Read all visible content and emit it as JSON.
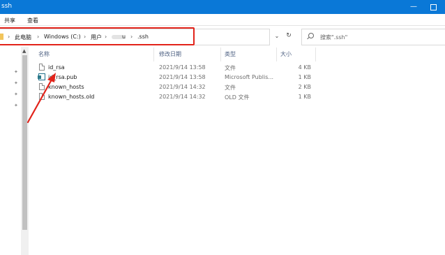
{
  "window": {
    "title": "ssh"
  },
  "ribbon": {
    "tabs": [
      "共享",
      "查看"
    ]
  },
  "address": {
    "crumbs": [
      "此电脑",
      "Windows (C:)",
      "用户",
      "u",
      ".ssh"
    ],
    "separator": "›"
  },
  "search": {
    "placeholder": "搜索\".ssh\""
  },
  "columns": {
    "name": "名称",
    "modified": "修改日期",
    "type": "类型",
    "size": "大小"
  },
  "files": [
    {
      "name": "id_rsa",
      "modified": "2021/9/14 13:58",
      "type": "文件",
      "size": "4 KB",
      "icon": "file-icon"
    },
    {
      "name": "id_rsa.pub",
      "modified": "2021/9/14 13:58",
      "type": "Microsoft Publis...",
      "size": "1 KB",
      "icon": "publisher-file-icon"
    },
    {
      "name": "known_hosts",
      "modified": "2021/9/14 14:32",
      "type": "文件",
      "size": "2 KB",
      "icon": "file-icon"
    },
    {
      "name": "known_hosts.old",
      "modified": "2021/9/14 14:32",
      "type": "OLD 文件",
      "size": "1 KB",
      "icon": "file-icon"
    }
  ],
  "colors": {
    "titlebar": "#0a78d7",
    "highlight": "#e2231a",
    "header_text": "#4d6082"
  }
}
